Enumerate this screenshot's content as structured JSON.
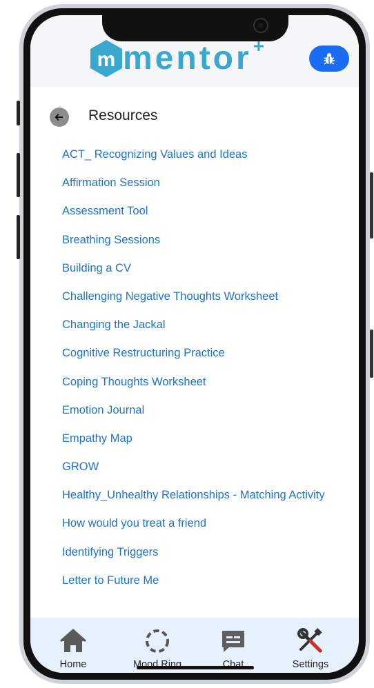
{
  "app": {
    "logo_text": "mentor",
    "logo_plus": "+",
    "logo_letter": "m",
    "brand_color": "#3aa7cc",
    "accent_color": "#1a6df2"
  },
  "header": {
    "bug_button_icon": "bug-icon"
  },
  "page": {
    "back_icon": "arrow-left-icon",
    "title": "Resources"
  },
  "resources": [
    "ACT_ Recognizing Values and Ideas",
    "Affirmation Session",
    "Assessment Tool",
    "Breathing Sessions",
    "Building a CV",
    "Challenging Negative Thoughts Worksheet",
    "Changing the Jackal",
    "Cognitive Restructuring Practice",
    "Coping Thoughts Worksheet",
    "Emotion Journal",
    "Empathy Map",
    "GROW",
    "Healthy_Unhealthy Relationships - Matching Activity",
    "How would you treat a friend",
    "Identifying Triggers",
    "Letter to Future Me"
  ],
  "tabbar": {
    "tabs": [
      {
        "label": "Home",
        "icon": "home-icon"
      },
      {
        "label": "Mood Ring",
        "icon": "mood-ring-icon"
      },
      {
        "label": "Chat",
        "icon": "chat-icon"
      },
      {
        "label": "Settings",
        "icon": "tools-icon"
      }
    ]
  }
}
